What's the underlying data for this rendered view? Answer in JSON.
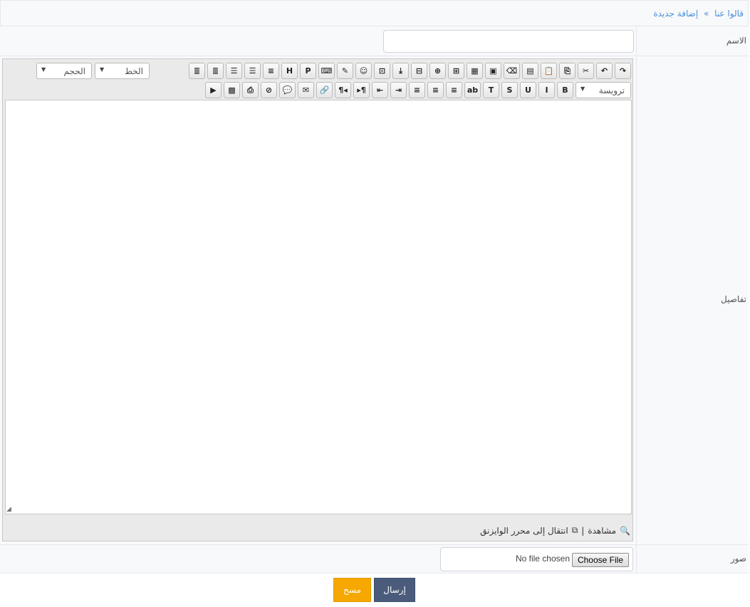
{
  "breadcrumb": {
    "parent": "قالوا عنا",
    "separator": "»",
    "current": "إضافة جديدة"
  },
  "form": {
    "name_label": "الاسم",
    "details_label": "تفاصيل",
    "images_label": "صور"
  },
  "editor": {
    "toolbar_row1": [
      {
        "icon": "redo-icon",
        "glyph": "↷"
      },
      {
        "icon": "undo-icon",
        "glyph": "↶"
      },
      {
        "icon": "cut-icon",
        "glyph": "✂"
      },
      {
        "icon": "copy-icon",
        "glyph": "⎘"
      },
      {
        "icon": "paste-icon",
        "glyph": "📋"
      },
      {
        "icon": "paste-text-icon",
        "glyph": "▤"
      },
      {
        "icon": "remove-format-icon",
        "glyph": "⌫"
      },
      {
        "icon": "insert-video-icon",
        "glyph": "▣"
      },
      {
        "icon": "insert-table-icon",
        "glyph": "▦"
      },
      {
        "icon": "insert-image-icon",
        "glyph": "⊞"
      },
      {
        "icon": "insert-image-plus-icon",
        "glyph": "⊕"
      },
      {
        "icon": "insert-bbcode-icon",
        "glyph": "⊟"
      },
      {
        "icon": "insert-quote-down-icon",
        "glyph": "⤓"
      },
      {
        "icon": "insert-bbcode-down-icon",
        "glyph": "⊡"
      },
      {
        "icon": "emoticon-icon",
        "glyph": "☺"
      },
      {
        "icon": "edit-source-icon",
        "glyph": "✎"
      },
      {
        "icon": "code-icon",
        "glyph": "⌨"
      },
      {
        "icon": "php-icon",
        "glyph": "P"
      },
      {
        "icon": "html-icon",
        "glyph": "H"
      },
      {
        "icon": "ordered-list-icon",
        "glyph": "≡"
      },
      {
        "icon": "unordered-list-icon",
        "glyph": "☰"
      },
      {
        "icon": "bullet-list-icon",
        "glyph": "☰"
      },
      {
        "icon": "numbered-list-icon",
        "glyph": "≣"
      },
      {
        "icon": "checklist-icon",
        "glyph": "≣"
      }
    ],
    "font_label": "الخط",
    "size_label": "الحجم",
    "heading_label": "ترويسة",
    "toolbar_row2": [
      {
        "icon": "bold-icon",
        "glyph": "B"
      },
      {
        "icon": "italic-icon",
        "glyph": "I"
      },
      {
        "icon": "underline-icon",
        "glyph": "U"
      },
      {
        "icon": "strikethrough-icon",
        "glyph": "S"
      },
      {
        "icon": "text-color-icon",
        "glyph": "T"
      },
      {
        "icon": "highlight-icon",
        "glyph": "ab"
      },
      {
        "icon": "align-right-icon",
        "glyph": "≡"
      },
      {
        "icon": "align-center-icon",
        "glyph": "≡"
      },
      {
        "icon": "align-left-icon",
        "glyph": "≡"
      },
      {
        "icon": "indent-icon",
        "glyph": "⇥"
      },
      {
        "icon": "outdent-icon",
        "glyph": "⇤"
      },
      {
        "icon": "ltr-icon",
        "glyph": "▸¶"
      },
      {
        "icon": "rtl-icon",
        "glyph": "¶◂"
      },
      {
        "icon": "link-icon",
        "glyph": "🔗"
      },
      {
        "icon": "email-icon",
        "glyph": "✉"
      },
      {
        "icon": "quote-icon",
        "glyph": "💬"
      },
      {
        "icon": "unlink-icon",
        "glyph": "⊘"
      },
      {
        "icon": "attachment-icon",
        "glyph": "⎙"
      },
      {
        "icon": "gallery-icon",
        "glyph": "▩"
      },
      {
        "icon": "media-icon",
        "glyph": "▶"
      }
    ],
    "footer_preview": "مشاهدة",
    "footer_divider": "|",
    "footer_switch": "انتقال إلى محرر الوايزنق"
  },
  "file": {
    "button_label": "Choose File",
    "status": "No file chosen"
  },
  "actions": {
    "submit": "إرسال",
    "clear": "مسح"
  },
  "colors": {
    "submit_bg": "#4a5b7c",
    "clear_bg": "#f6a800",
    "link": "#4a90d9"
  }
}
